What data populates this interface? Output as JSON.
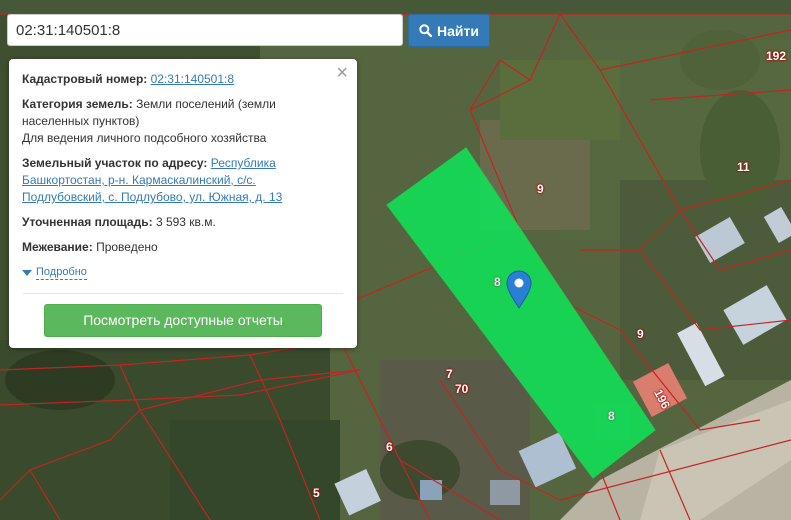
{
  "search": {
    "value": "02:31:140501:8",
    "button_label": "Найти"
  },
  "panel": {
    "cadastral_label": "Кадастровый номер:",
    "cadastral_value": "02:31:140501:8",
    "category_label": "Категория земель:",
    "category_value_1": "Земли поселений (земли",
    "category_value_2": "населенных пунктов)",
    "category_purpose": "Для ведения личного подсобного хозяйства",
    "address_label": "Земельный участок по адресу:",
    "address_line_1": "Республика",
    "address_line_2": "Башкортостан, р-н. Кармаскалинский, с/с.",
    "address_line_3": "Подлубовский, с. Подлубово, ул. Южная, д. 13",
    "area_label": "Уточненная площадь:",
    "area_value": "3 593 кв.м.",
    "survey_label": "Межевание:",
    "survey_value": "Проведено",
    "more_label": "Подробно",
    "report_button": "Посмотреть доступные отчеты"
  },
  "map_labels": {
    "l192": "192",
    "l11": "11",
    "l9a": "9",
    "l8a": "8",
    "l9b": "9",
    "l7": "7",
    "l70": "70",
    "l6": "6",
    "l5": "5",
    "l196": "196",
    "l8b": "8"
  }
}
